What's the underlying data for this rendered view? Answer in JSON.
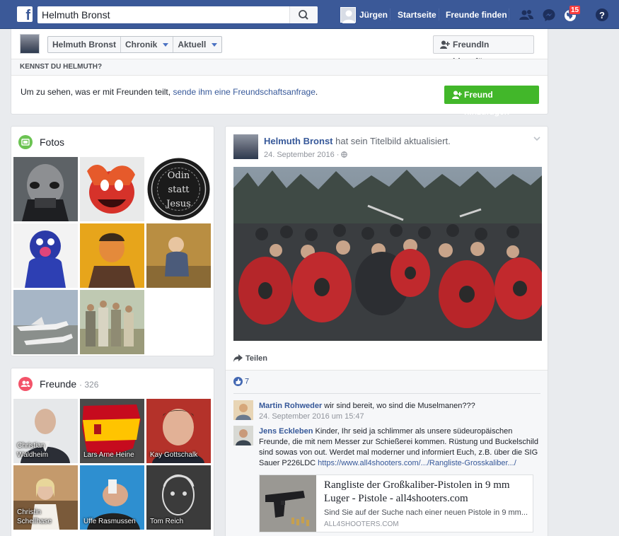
{
  "topbar": {
    "logo": "f",
    "search_value": "Helmuth Bronst",
    "user_name": "Jürgen",
    "home_label": "Startseite",
    "find_friends_label": "Freunde finden",
    "notification_count": "15",
    "icons": [
      "friend-requests-icon",
      "messenger-icon",
      "notifications-globe-icon",
      "help-icon"
    ],
    "brand_color": "#3b5998"
  },
  "profile": {
    "name_tab": "Helmuth Bronst",
    "chronik_tab": "Chronik",
    "aktuell_tab": "Aktuell",
    "add_friend_label": "FreundIn hinzufügen",
    "kennst_header": "KENNST DU HELMUTH?",
    "kennst_text": "Um zu sehen, was er mit Freunden teilt,",
    "kennst_link": "sende ihm eine Freundschaftsanfrage",
    "kennst_end": ".",
    "add_friend_green_label": "Freund hinzufügen"
  },
  "photos": {
    "title": "Fotos"
  },
  "friends": {
    "title": "Freunde",
    "count": "· 326",
    "list": [
      {
        "name": "Christian Waldheim"
      },
      {
        "name": "Lars Arne Heine"
      },
      {
        "name": "Kay Gottschalk"
      },
      {
        "name": "Christin Schellhase"
      },
      {
        "name": "Uffe Rasmussen"
      },
      {
        "name": "Tom Reich"
      }
    ]
  },
  "post": {
    "author": "Helmuth Bronst",
    "action": "hat sein Titelbild aktualisiert.",
    "date": "24. September 2016 ·",
    "share_label": "Teilen",
    "likes": "7",
    "comments": [
      {
        "author": "Martin Rohweder",
        "text": "wir sind bereit, wo sind die Muselmanen???",
        "meta": "24. September 2016 um 15:47"
      },
      {
        "author": "Jens Eckleben",
        "text": "Kinder, Ihr seid ja schlimmer als unsere südeuropäischen Freunde, die mit nem Messer zur Schießerei kommen. Rüstung und Buckelschild sind sowas von out. Werdet mal moderner und informiert Euch, z.B. über die SIG Sauer P226LDC",
        "link": "https://www.all4shooters.com/.../Rangliste-Grosskaliber.../"
      }
    ],
    "preview": {
      "title": "Rangliste der Großkaliber-Pistolen in 9 mm Luger - Pistole - all4shooters.com",
      "description": "Sind Sie auf der Suche nach einer neuen Pistole in 9 mm...",
      "domain": "ALL4SHOOTERS.COM"
    }
  }
}
